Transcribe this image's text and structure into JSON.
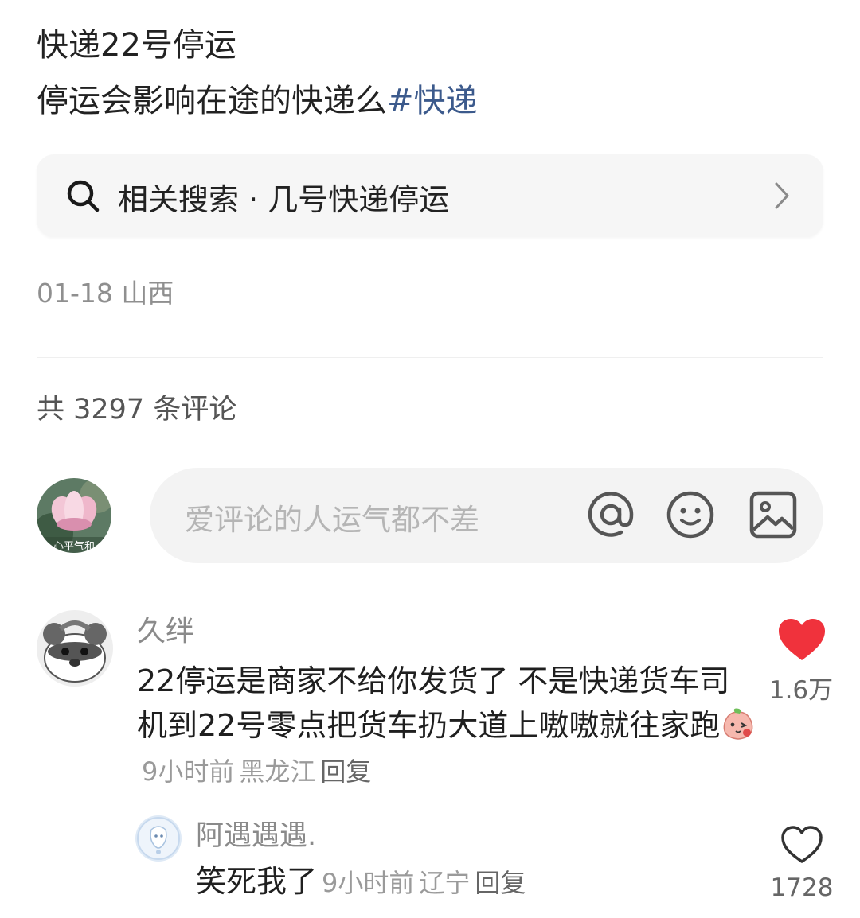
{
  "post": {
    "title": "快递22号停运",
    "body": "停运会影响在途的快递么",
    "hashtag": "#快递"
  },
  "related_search": {
    "icon": "search-icon",
    "label": "相关搜索 · 几号快递停运"
  },
  "post_meta": {
    "date": "01-18",
    "location": "山西"
  },
  "comments_header": {
    "count_text": "共 3297 条评论"
  },
  "comment_input": {
    "placeholder": "爱评论的人运气都不差",
    "avatar_caption": "心平气和",
    "tools": [
      "at-icon",
      "emoji-icon",
      "image-icon"
    ]
  },
  "comments": [
    {
      "user": "久绊",
      "text": "22停运是商家不给你发货了 不是快递货车司机到22号零点把货车扔大道上嗷嗷就往家跑",
      "time": "9小时前",
      "location": "黑龙江",
      "reply_label": "回复",
      "likes": "1.6万",
      "liked": true,
      "like_color": "#f0323c"
    }
  ],
  "replies": [
    {
      "user": "阿遇遇遇.",
      "text": "笑死我了",
      "time": "9小时前",
      "location": "辽宁",
      "reply_label": "回复",
      "likes": "1728",
      "liked": false
    }
  ]
}
